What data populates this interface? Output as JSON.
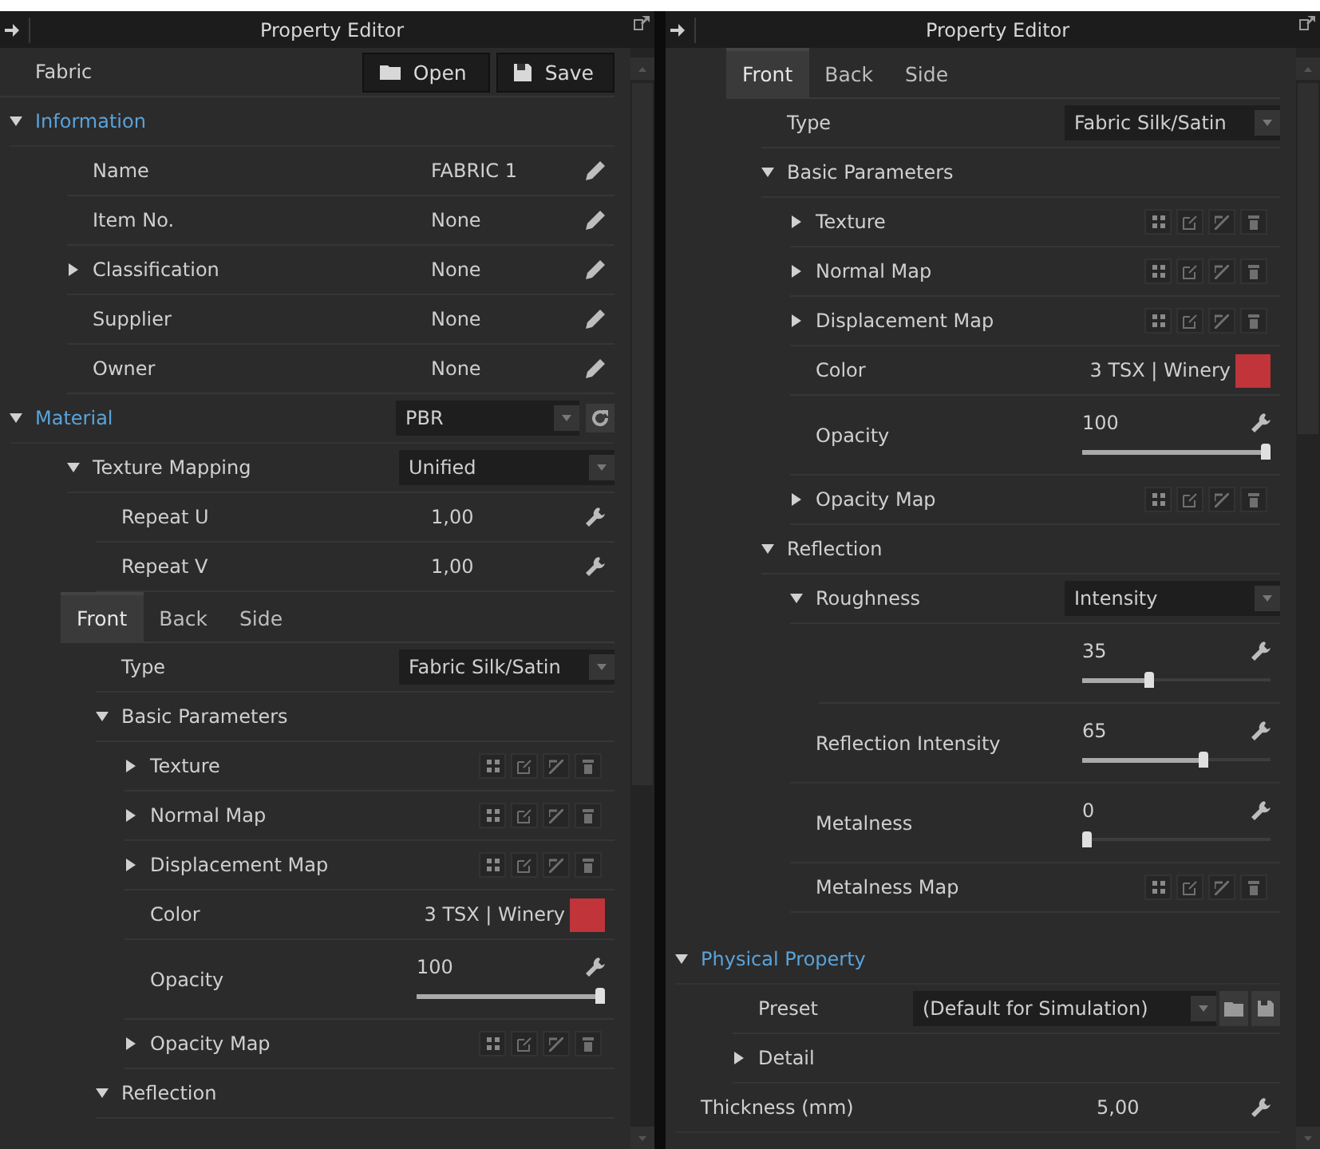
{
  "panels": [
    {
      "title": "Property Editor",
      "items": [
        {
          "kind": "file",
          "label": "Fabric",
          "buttons": [
            {
              "label": "Open"
            },
            {
              "label": "Save"
            }
          ]
        },
        {
          "kind": "section",
          "label": "Information",
          "expanded": true,
          "children": [
            {
              "kind": "text_field",
              "label": "Name",
              "value": "FABRIC 1"
            },
            {
              "kind": "text_field",
              "label": "Item No.",
              "value": "None"
            },
            {
              "kind": "text_field",
              "label": "Classification",
              "value": "None",
              "expanded": false
            },
            {
              "kind": "text_field",
              "label": "Supplier",
              "value": "None"
            },
            {
              "kind": "text_field",
              "label": "Owner",
              "value": "None"
            }
          ]
        },
        {
          "kind": "section",
          "label": "Material",
          "expanded": true,
          "dropdown": "PBR",
          "children": [
            {
              "kind": "dropdown",
              "label": "Texture Mapping",
              "value": "Unified",
              "expanded": true,
              "children": [
                {
                  "kind": "number_field",
                  "label": "Repeat U",
                  "value": "1,00"
                },
                {
                  "kind": "number_field",
                  "label": "Repeat V",
                  "value": "1,00"
                }
              ]
            },
            {
              "kind": "tabs",
              "tabs": [
                {
                  "label": "Front",
                  "selected": true
                },
                {
                  "label": "Back",
                  "selected": false
                },
                {
                  "label": "Side",
                  "selected": false
                }
              ],
              "children": [
                {
                  "kind": "dropdown",
                  "label": "Type",
                  "value": "Fabric  Silk/Satin"
                },
                {
                  "kind": "group",
                  "label": "Basic Parameters",
                  "expanded": true,
                  "children": [
                    {
                      "kind": "map",
                      "label": "Texture",
                      "expanded": false
                    },
                    {
                      "kind": "map",
                      "label": "Normal Map",
                      "expanded": false
                    },
                    {
                      "kind": "map",
                      "label": "Displacement Map",
                      "expanded": false
                    },
                    {
                      "kind": "color",
                      "label": "Color",
                      "value": "3 TSX | Winery",
                      "color": "#c0343a"
                    },
                    {
                      "kind": "slider",
                      "label": "Opacity",
                      "value": "100",
                      "level": 1.0
                    },
                    {
                      "kind": "map",
                      "label": "Opacity Map",
                      "expanded": false
                    }
                  ]
                },
                {
                  "kind": "group",
                  "label": "Reflection",
                  "expanded": true
                }
              ]
            }
          ]
        }
      ]
    },
    {
      "title": "Property Editor",
      "items": [
        {
          "kind": "tabs",
          "tabs": [
            {
              "label": "Front",
              "selected": true
            },
            {
              "label": "Back",
              "selected": false
            },
            {
              "label": "Side",
              "selected": false
            }
          ],
          "children": [
            {
              "kind": "dropdown",
              "label": "Type",
              "value": "Fabric  Silk/Satin"
            },
            {
              "kind": "group",
              "label": "Basic Parameters",
              "expanded": true,
              "children": [
                {
                  "kind": "map",
                  "label": "Texture",
                  "expanded": false
                },
                {
                  "kind": "map",
                  "label": "Normal Map",
                  "expanded": false
                },
                {
                  "kind": "map",
                  "label": "Displacement Map",
                  "expanded": false
                },
                {
                  "kind": "color",
                  "label": "Color",
                  "value": "3 TSX | Winery",
                  "color": "#c0343a"
                },
                {
                  "kind": "slider",
                  "label": "Opacity",
                  "value": "100",
                  "level": 1.0
                },
                {
                  "kind": "map",
                  "label": "Opacity Map",
                  "expanded": false
                }
              ]
            },
            {
              "kind": "group",
              "label": "Reflection",
              "expanded": true,
              "children": [
                {
                  "kind": "dropdown",
                  "label": "Roughness",
                  "value": "Intensity",
                  "expanded": true,
                  "children": [
                    {
                      "kind": "slider",
                      "value": "35",
                      "level": 0.35
                    }
                  ]
                },
                {
                  "kind": "slider",
                  "label": "Reflection Intensity",
                  "value": "65",
                  "level": 0.65
                },
                {
                  "kind": "slider",
                  "label": "Metalness",
                  "value": "0",
                  "level": 0.0
                },
                {
                  "kind": "map",
                  "label": "Metalness Map"
                }
              ]
            }
          ]
        },
        {
          "kind": "section",
          "label": "Physical Property",
          "expanded": true,
          "children": [
            {
              "kind": "preset",
              "label": "Preset",
              "value": "(Default  for  Simulation)"
            },
            {
              "kind": "group",
              "label": "Detail",
              "expanded": false
            }
          ]
        },
        {
          "kind": "number_field",
          "label": "Thickness (mm)",
          "value": "5,00"
        }
      ]
    }
  ]
}
